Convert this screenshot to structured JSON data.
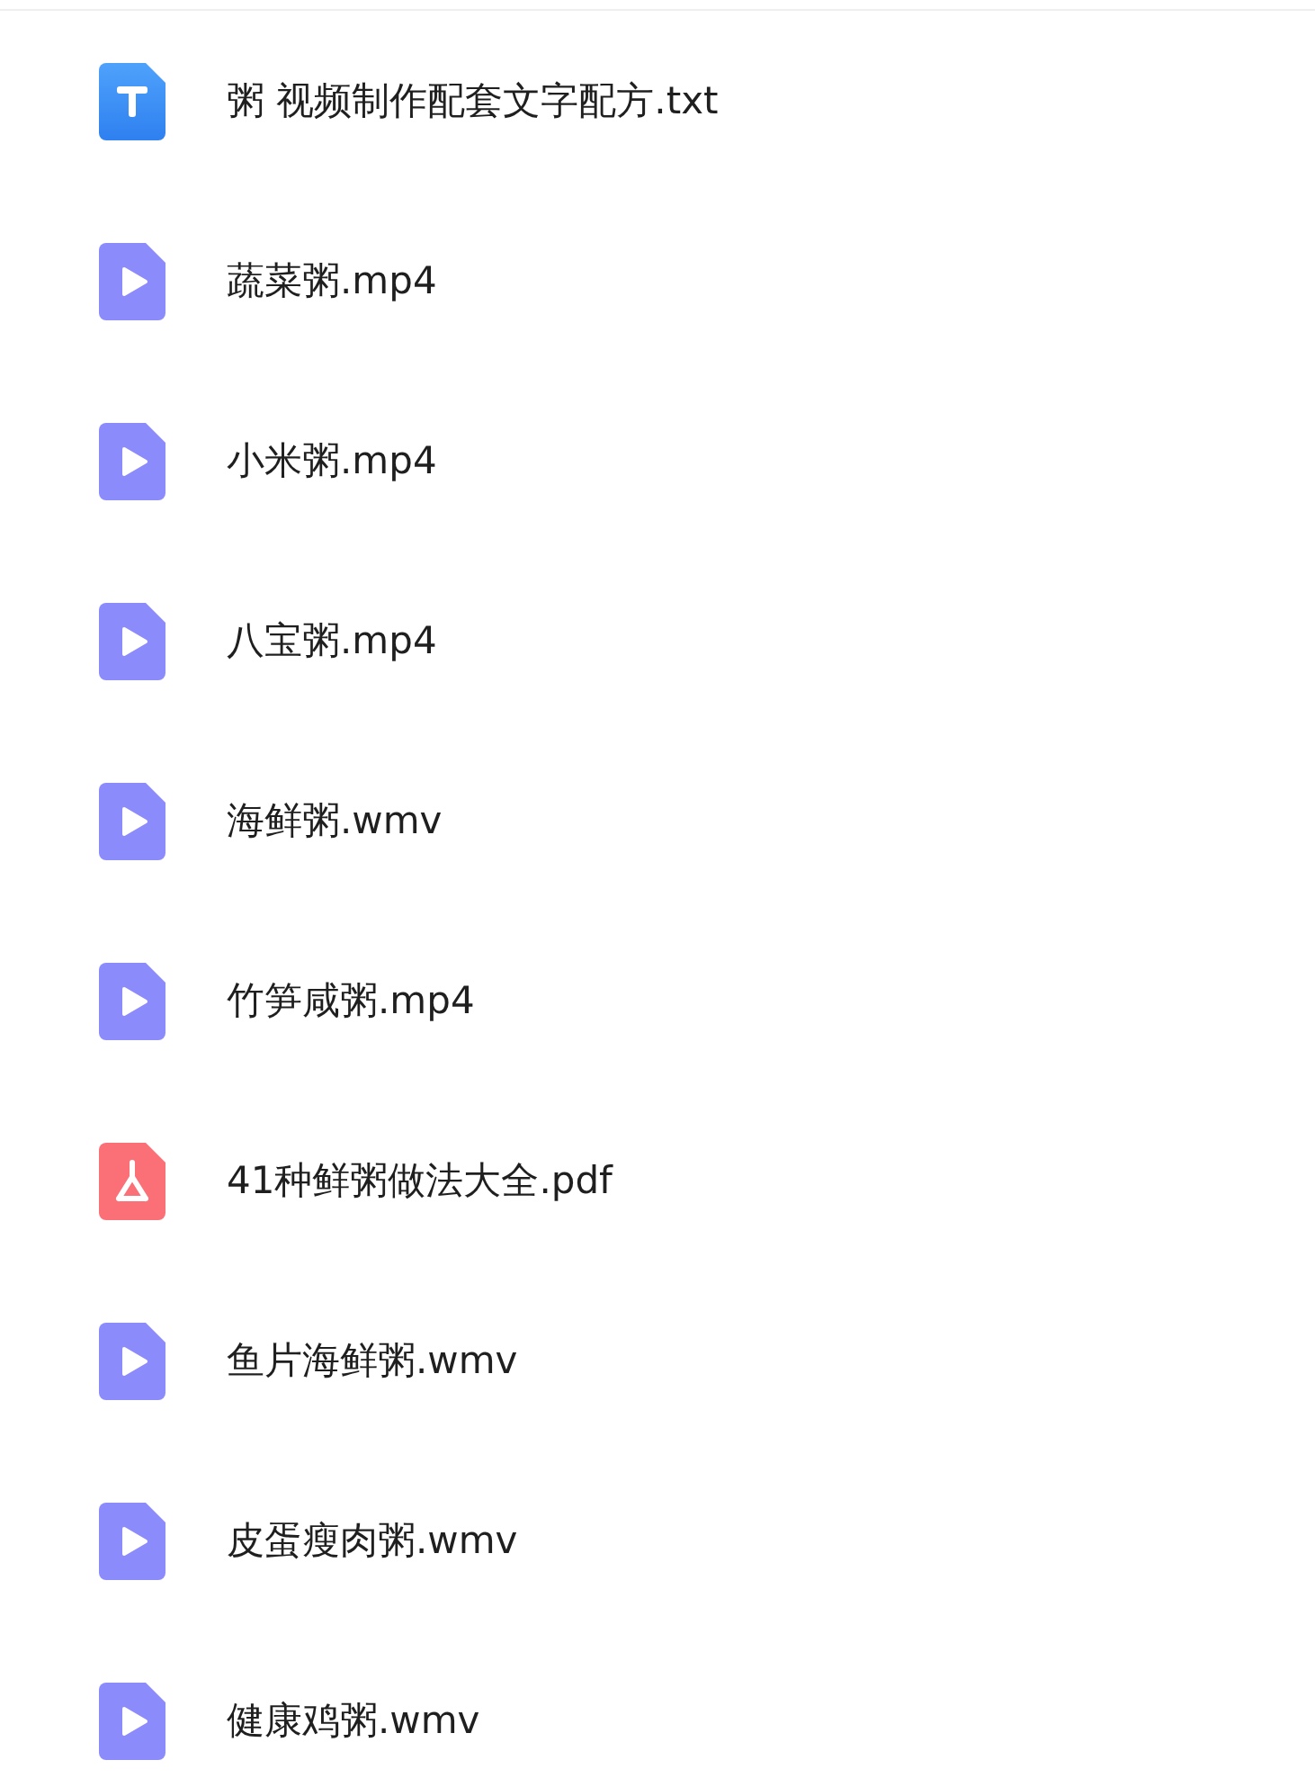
{
  "files": [
    {
      "kind": "text",
      "name": "粥 视频制作配套文字配方.txt"
    },
    {
      "kind": "video",
      "name": "蔬菜粥.mp4"
    },
    {
      "kind": "video",
      "name": "小米粥.mp4"
    },
    {
      "kind": "video",
      "name": "八宝粥.mp4"
    },
    {
      "kind": "video",
      "name": "海鲜粥.wmv"
    },
    {
      "kind": "video",
      "name": "竹笋咸粥.mp4"
    },
    {
      "kind": "pdf",
      "name": "41种鲜粥做法大全.pdf"
    },
    {
      "kind": "video",
      "name": "鱼片海鲜粥.wmv"
    },
    {
      "kind": "video",
      "name": "皮蛋瘦肉粥.wmv"
    },
    {
      "kind": "video",
      "name": "健康鸡粥.wmv"
    }
  ]
}
